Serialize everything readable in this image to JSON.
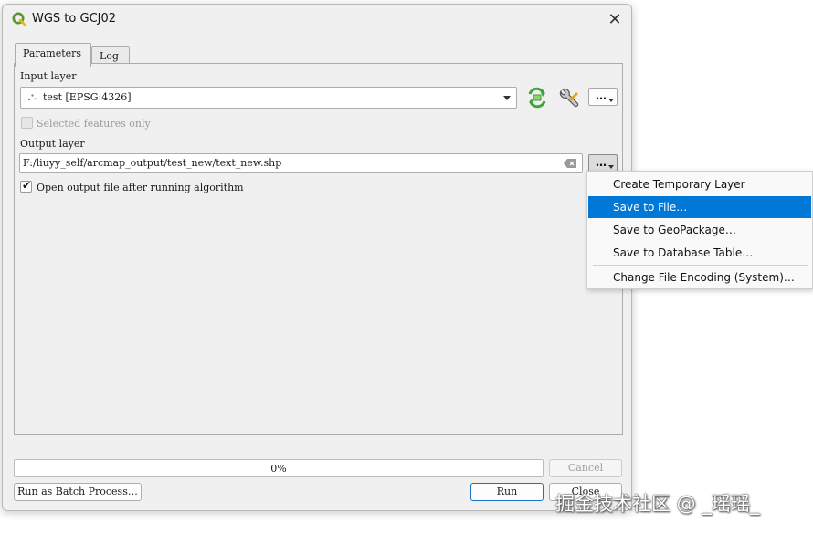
{
  "window": {
    "title": "WGS to GCJ02",
    "close_glyph": "✕"
  },
  "tabs": [
    {
      "label": "Parameters"
    },
    {
      "label": "Log"
    }
  ],
  "input_layer": {
    "label": "Input layer",
    "value": "test [EPSG:4326]",
    "selected_only_label": "Selected features only",
    "selected_only_checked": false
  },
  "output_layer": {
    "label": "Output layer",
    "value": "F:/liuyy_self/arcmap_output/test_new/text_new.shp",
    "open_after_label": "Open output file after running algorithm",
    "open_after_checked": true
  },
  "dots_label": "…",
  "output_menu": {
    "items": [
      {
        "label": "Create Temporary Layer",
        "selected": false
      },
      {
        "label": "Save to File…",
        "selected": true
      },
      {
        "label": "Save to GeoPackage…",
        "selected": false
      },
      {
        "label": "Save to Database Table…",
        "selected": false
      },
      {
        "label": "Change File Encoding (System)…",
        "selected": false
      }
    ]
  },
  "progress": {
    "value": 0,
    "text": "0%"
  },
  "buttons": {
    "cancel": "Cancel",
    "batch": "Run as Batch Process…",
    "run": "Run",
    "close": "Close"
  },
  "icons": {
    "app": "qgis-logo-icon",
    "iterate": "iterate-icon",
    "advanced": "wrench-icon",
    "clear": "clear-text-icon"
  },
  "colors": {
    "accent": "#0078d7",
    "qgis_green": "#589632",
    "progress_green": "#06b025"
  },
  "watermark": "掘金技术社区 @ _瑶瑶_"
}
